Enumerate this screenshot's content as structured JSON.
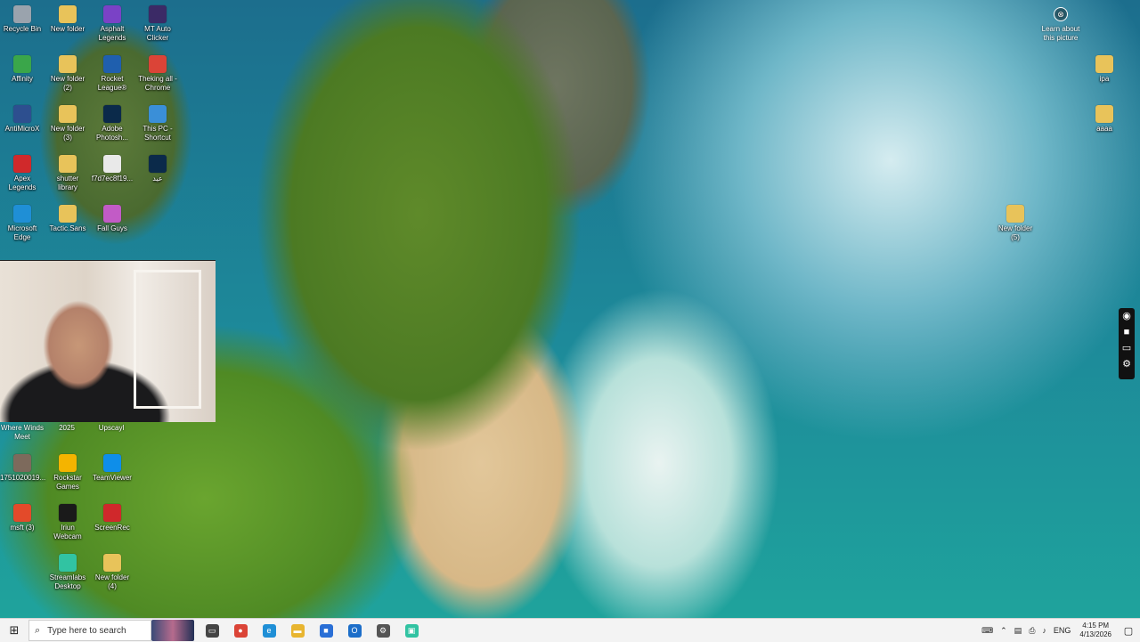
{
  "desktop": {
    "icons_col1": [
      {
        "name": "recycle-bin-icon",
        "label": "Recycle Bin",
        "color": "#9aa3ad"
      },
      {
        "name": "affinity-icon",
        "label": "Affinity",
        "color": "#3aa64a"
      },
      {
        "name": "antimicrox-icon",
        "label": "AntiMicroX",
        "color": "#2d4f8f"
      },
      {
        "name": "apex-legends-icon",
        "label": "Apex\nLegends",
        "color": "#d0292b"
      },
      {
        "name": "microsoft-edge-icon",
        "label": "Microsoft\nEdge",
        "color": "#1f8fd6"
      }
    ],
    "icons_col2": [
      {
        "name": "folder-icon",
        "label": "New folder",
        "color": "#e8c35a"
      },
      {
        "name": "folder-icon",
        "label": "New folder\n(2)",
        "color": "#e8c35a"
      },
      {
        "name": "folder-icon",
        "label": "New folder\n(3)",
        "color": "#e8c35a"
      },
      {
        "name": "folder-icon",
        "label": "shutter\nlibrary",
        "color": "#e8c35a"
      },
      {
        "name": "folder-icon",
        "label": "Tactic.Sans",
        "color": "#e8c35a"
      }
    ],
    "icons_col3": [
      {
        "name": "asphalt-legends-icon",
        "label": "Asphalt\nLegends",
        "color": "#7a42c6"
      },
      {
        "name": "rocket-league-icon",
        "label": "Rocket\nLeague®",
        "color": "#1f5fae"
      },
      {
        "name": "photoshop-icon",
        "label": "Adobe\nPhotosh...",
        "color": "#0b2a4a"
      },
      {
        "name": "file-icon",
        "label": "f7d7ec8f19...",
        "color": "#e9e9e9"
      },
      {
        "name": "fall-guys-icon",
        "label": "Fall Guys",
        "color": "#c25bc6"
      }
    ],
    "icons_col4": [
      {
        "name": "auto-clicker-icon",
        "label": "MT Auto\nClicker",
        "color": "#3b2a66"
      },
      {
        "name": "chrome-icon",
        "label": "Theking all -\nChrome",
        "color": "#db4437"
      },
      {
        "name": "this-pc-shortcut-icon",
        "label": "This PC -\nShortcut",
        "color": "#3a8fd8"
      },
      {
        "name": "photoshop-rd-icon",
        "label": "عيد",
        "color": "#0b2a4a"
      }
    ],
    "icons_lower_col1": [
      {
        "name": "photo-file-icon",
        "label": "1751020019...",
        "color": "#7d6a5c"
      },
      {
        "name": "msft-icon",
        "label": "msft (3)",
        "color": "#e34a2a"
      }
    ],
    "icons_lower_col2": [
      {
        "name": "rockstar-games-icon",
        "label": "Rockstar\nGames",
        "color": "#f4b400"
      },
      {
        "name": "iriun-webcam-icon",
        "label": "Iriun\nWebcam",
        "color": "#1a1a1a"
      },
      {
        "name": "streamlabs-icon",
        "label": "Streamlabs\nDesktop",
        "color": "#31c3a2"
      }
    ],
    "icons_lower_col3": [
      {
        "name": "teamviewer-icon",
        "label": "TeamViewer",
        "color": "#0e8ee9"
      },
      {
        "name": "screenrec-icon",
        "label": "ScreenRec",
        "color": "#d0282b"
      },
      {
        "name": "folder-icon",
        "label": "New folder\n(4)",
        "color": "#e8c35a"
      }
    ],
    "cam_row_labels": [
      "Where Winds\nMeet",
      "2025",
      "Upscayl"
    ],
    "right_icons": [
      {
        "name": "file-icon",
        "label": "ipa",
        "color": "#e8c35a"
      },
      {
        "name": "folder-icon",
        "label": "aaaa",
        "color": "#e8c35a"
      },
      {
        "name": "folder-icon",
        "label": "New folder\n(5)",
        "color": "#e8c35a"
      }
    ],
    "learn_label": "Learn about\nthis picture"
  },
  "taskbar": {
    "search_placeholder": "Type here to search",
    "pinned": [
      {
        "name": "task-view-icon",
        "color": "#444444",
        "glyph": "▭"
      },
      {
        "name": "chrome-taskbar-icon",
        "color": "#db4437",
        "glyph": "●"
      },
      {
        "name": "edge-taskbar-icon",
        "color": "#1f8fd6",
        "glyph": "e"
      },
      {
        "name": "file-explorer-icon",
        "color": "#e8b530",
        "glyph": "▬"
      },
      {
        "name": "store-icon",
        "color": "#2a6fd6",
        "glyph": "■"
      },
      {
        "name": "outlook-icon",
        "color": "#1c6ec9",
        "glyph": "O"
      },
      {
        "name": "settings-icon",
        "color": "#555555",
        "glyph": "⚙"
      },
      {
        "name": "streamlabs-taskbar-icon",
        "color": "#31c3a2",
        "glyph": "▣"
      }
    ],
    "tray_lang": "ENG",
    "time": "4:15 PM",
    "date": "4/13/2026"
  }
}
